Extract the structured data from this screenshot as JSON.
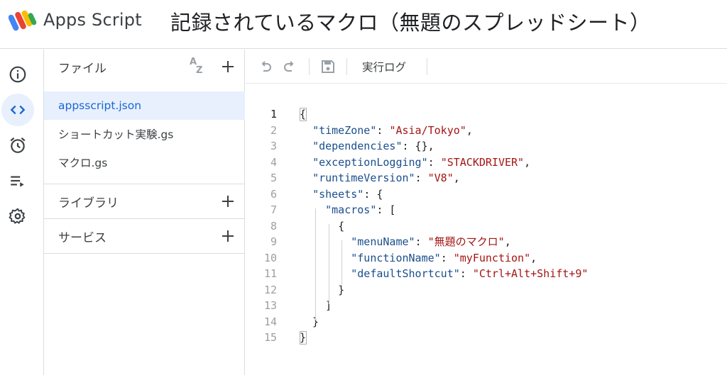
{
  "header": {
    "app_name": "Apps Script",
    "project_title": "記録されているマクロ（無題のスプレッドシート）"
  },
  "rail": {
    "items": [
      {
        "name": "overview",
        "icon": "info-icon",
        "active": false
      },
      {
        "name": "editor",
        "icon": "code-icon",
        "active": true
      },
      {
        "name": "triggers",
        "icon": "alarm-clock-icon",
        "active": false
      },
      {
        "name": "executions",
        "icon": "executions-list-icon",
        "active": false
      },
      {
        "name": "settings",
        "icon": "gear-icon",
        "active": false
      }
    ]
  },
  "files_panel": {
    "files_label": "ファイル",
    "files": [
      {
        "name": "appsscript.json",
        "selected": true
      },
      {
        "name": "ショートカット実験.gs",
        "selected": false
      },
      {
        "name": "マクロ.gs",
        "selected": false
      }
    ],
    "libraries_label": "ライブラリ",
    "services_label": "サービス"
  },
  "toolbar": {
    "execution_log_label": "実行ログ"
  },
  "editor": {
    "line_numbers": [
      "1",
      "2",
      "3",
      "4",
      "5",
      "6",
      "7",
      "8",
      "9",
      "10",
      "11",
      "12",
      "13",
      "14",
      "15"
    ],
    "current_line": "1",
    "lines": [
      [
        {
          "t": "p",
          "v": "{"
        }
      ],
      [
        {
          "t": "p",
          "v": "  "
        },
        {
          "t": "k",
          "v": "\"timeZone\""
        },
        {
          "t": "p",
          "v": ": "
        },
        {
          "t": "s",
          "v": "\"Asia/Tokyo\""
        },
        {
          "t": "p",
          "v": ","
        }
      ],
      [
        {
          "t": "p",
          "v": "  "
        },
        {
          "t": "k",
          "v": "\"dependencies\""
        },
        {
          "t": "p",
          "v": ": {},"
        }
      ],
      [
        {
          "t": "p",
          "v": "  "
        },
        {
          "t": "k",
          "v": "\"exceptionLogging\""
        },
        {
          "t": "p",
          "v": ": "
        },
        {
          "t": "s",
          "v": "\"STACKDRIVER\""
        },
        {
          "t": "p",
          "v": ","
        }
      ],
      [
        {
          "t": "p",
          "v": "  "
        },
        {
          "t": "k",
          "v": "\"runtimeVersion\""
        },
        {
          "t": "p",
          "v": ": "
        },
        {
          "t": "s",
          "v": "\"V8\""
        },
        {
          "t": "p",
          "v": ","
        }
      ],
      [
        {
          "t": "p",
          "v": "  "
        },
        {
          "t": "k",
          "v": "\"sheets\""
        },
        {
          "t": "p",
          "v": ": {"
        }
      ],
      [
        {
          "t": "p",
          "v": "    "
        },
        {
          "t": "k",
          "v": "\"macros\""
        },
        {
          "t": "p",
          "v": ": ["
        }
      ],
      [
        {
          "t": "p",
          "v": "      {"
        }
      ],
      [
        {
          "t": "p",
          "v": "        "
        },
        {
          "t": "k",
          "v": "\"menuName\""
        },
        {
          "t": "p",
          "v": ": "
        },
        {
          "t": "s",
          "v": "\"無題のマクロ\""
        },
        {
          "t": "p",
          "v": ","
        }
      ],
      [
        {
          "t": "p",
          "v": "        "
        },
        {
          "t": "k",
          "v": "\"functionName\""
        },
        {
          "t": "p",
          "v": ": "
        },
        {
          "t": "s",
          "v": "\"myFunction\""
        },
        {
          "t": "p",
          "v": ","
        }
      ],
      [
        {
          "t": "p",
          "v": "        "
        },
        {
          "t": "k",
          "v": "\"defaultShortcut\""
        },
        {
          "t": "p",
          "v": ": "
        },
        {
          "t": "s",
          "v": "\"Ctrl+Alt+Shift+9\""
        }
      ],
      [
        {
          "t": "p",
          "v": "      }"
        }
      ],
      [
        {
          "t": "p",
          "v": "    ]"
        }
      ],
      [
        {
          "t": "p",
          "v": "  }"
        }
      ],
      [
        {
          "t": "p",
          "v": "}"
        }
      ]
    ]
  },
  "colors": {
    "accent": "#1967d2",
    "selected_bg": "#e8f0fe",
    "json_key": "#1a4e8c",
    "json_string": "#a31515"
  }
}
